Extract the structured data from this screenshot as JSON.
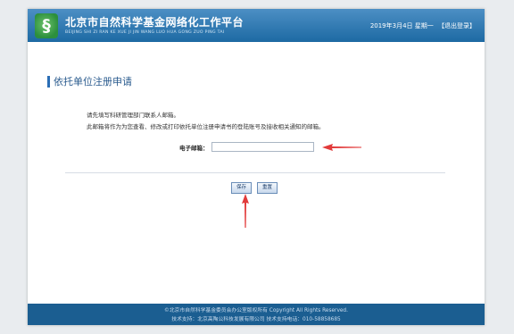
{
  "header": {
    "title": "北京市自然科学基金网络化工作平台",
    "subtitle": "BEIJING SHI ZI RAN KE XUE JI JIN WANG LUO HUA GONG ZUO PING TAI",
    "date": "2019年3月4日 星期一",
    "logout": "【退出登录】"
  },
  "page": {
    "title": "依托单位注册申请",
    "info_line1": "请先填写科研管理部门联系人邮箱。",
    "info_line2": "此邮箱将作为为您查看、修改或打印依托单位注册申请书的登陆账号及接收相关通知的邮箱。",
    "email_label": "电子邮箱：",
    "email_value": "",
    "save_label": "保存",
    "reset_label": "重置"
  },
  "footer": {
    "line1": "©北京市自然科学基金委员会办公室版权所有 Copyright All Rights Reserved.",
    "line2": "技术支持：北京高陶公科技发展有限公司 技术支持电话：010-58858685"
  },
  "colors": {
    "header_top": "#4c8fc4",
    "header_bottom": "#1d6aa3",
    "footer": "#1b5e91",
    "arrow": "#e23a3a",
    "title_accent": "#2a6eb5"
  },
  "icons": [
    "logo-icon",
    "red-arrow-left",
    "red-arrow-up"
  ]
}
